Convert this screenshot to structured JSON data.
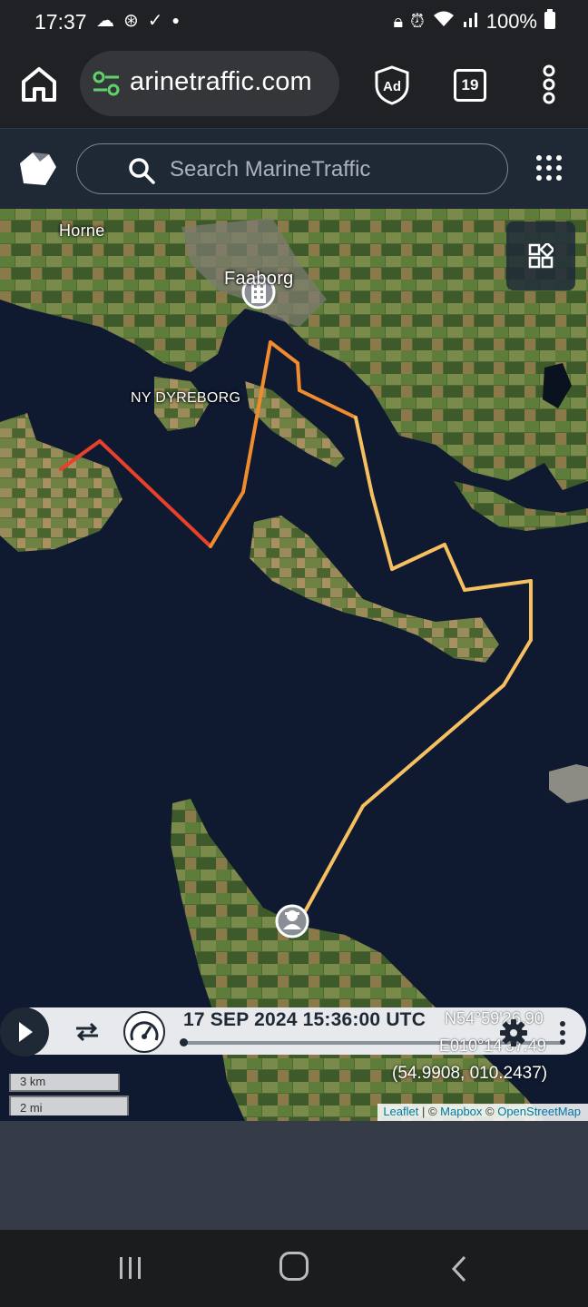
{
  "status_bar": {
    "time": "17:37",
    "battery": "100%",
    "left_icons": [
      "cloud-icon",
      "alarm-clock-icon",
      "check-icon",
      "dot-icon"
    ],
    "right_icons": [
      "lock-icon",
      "alarm-icon",
      "wifi-icon",
      "signal-icon",
      "battery-icon"
    ]
  },
  "browser": {
    "url": "arinetraffic.com",
    "tabs_count": "19",
    "ad_badge": "Ad"
  },
  "header": {
    "search_placeholder": "Search MarineTraffic"
  },
  "map": {
    "place_labels": {
      "horne": "Horne",
      "faaborg": "Faaborg",
      "ny_dyreborg": "NY DYREBORG"
    },
    "colors": {
      "track_start": "#e8402a",
      "track_mid": "#f08c2e",
      "track_end": "#f6c060",
      "water": "#0f1a30"
    },
    "track_points": [
      [
        54.9825,
        10.2605
      ],
      [
        54.9838,
        10.2616
      ],
      [
        54.9805,
        10.2688
      ],
      [
        54.9872,
        10.2743
      ],
      [
        54.9939,
        10.2675
      ],
      [
        54.993,
        10.2699
      ],
      [
        54.9907,
        10.274
      ],
      [
        54.9857,
        10.2779
      ],
      [
        54.9786,
        10.2785
      ],
      [
        54.9805,
        10.2817
      ],
      [
        54.9772,
        10.2851
      ],
      [
        54.9744,
        10.287
      ],
      [
        54.9612,
        10.2765
      ],
      [
        54.9461,
        10.2658
      ]
    ],
    "vessel_marker": "vessel-icon",
    "port_marker": "port-icon"
  },
  "playback": {
    "timestamp": "17 SEP 2024 15:36:00 UTC",
    "lat_dms": "N54°59'26.90",
    "lon_dms": "E010°14'37.49",
    "decimal": "(54.9908, 010.2437)",
    "progress": 0.01
  },
  "scale": {
    "km": "3 km",
    "mi": "2 mi"
  },
  "attribution": {
    "leaflet": "Leaflet",
    "sep1": " | © ",
    "mapbox": "Mapbox",
    "sep2": " © ",
    "osm": "OpenStreetMap"
  }
}
